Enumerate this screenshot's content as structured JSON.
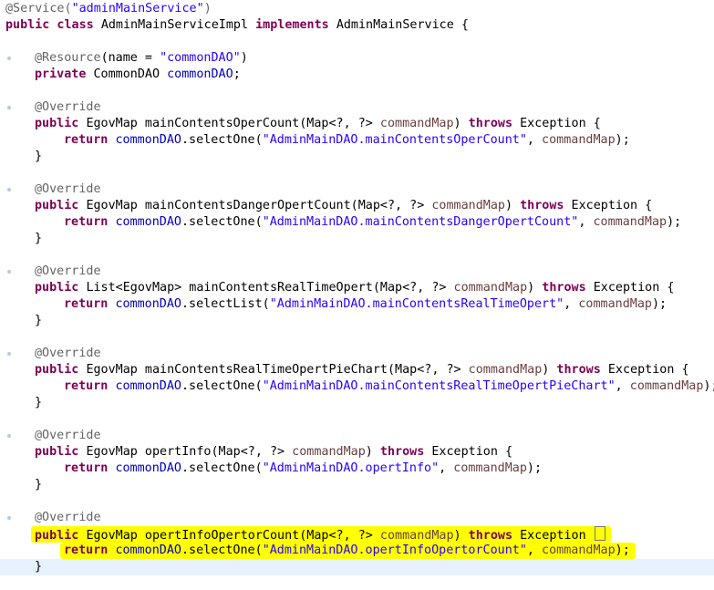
{
  "editor": {
    "lines": [
      {
        "indent": 0,
        "tokens": [
          {
            "t": "ann",
            "v": "@Service("
          },
          {
            "t": "str",
            "v": "\"adminMainService\""
          },
          {
            "t": "ann",
            "v": ")"
          }
        ]
      },
      {
        "indent": 0,
        "tokens": [
          {
            "t": "kw",
            "v": "public class "
          },
          {
            "t": "txt",
            "v": "AdminMainServiceImpl "
          },
          {
            "t": "kw",
            "v": "implements "
          },
          {
            "t": "txt",
            "v": "AdminMainService {"
          }
        ]
      },
      {
        "indent": 0,
        "tokens": []
      },
      {
        "indent": 1,
        "mark": true,
        "tokens": [
          {
            "t": "ann",
            "v": "@Resource"
          },
          {
            "t": "txt",
            "v": "(name = "
          },
          {
            "t": "str",
            "v": "\"commonDAO\""
          },
          {
            "t": "txt",
            "v": ")"
          }
        ]
      },
      {
        "indent": 1,
        "tokens": [
          {
            "t": "kw",
            "v": "private "
          },
          {
            "t": "txt",
            "v": "CommonDAO "
          },
          {
            "t": "fld",
            "v": "commonDAO"
          },
          {
            "t": "txt",
            "v": ";"
          }
        ]
      },
      {
        "indent": 0,
        "tokens": []
      },
      {
        "indent": 1,
        "mark": true,
        "tokens": [
          {
            "t": "ann",
            "v": "@Override"
          }
        ]
      },
      {
        "indent": 1,
        "tokens": [
          {
            "t": "kw",
            "v": "public "
          },
          {
            "t": "txt",
            "v": "EgovMap mainContentsOperCount(Map<?, ?> "
          },
          {
            "t": "prm",
            "v": "commandMap"
          },
          {
            "t": "txt",
            "v": ") "
          },
          {
            "t": "kw",
            "v": "throws "
          },
          {
            "t": "txt",
            "v": "Exception {"
          }
        ]
      },
      {
        "indent": 2,
        "tokens": [
          {
            "t": "kw",
            "v": "return "
          },
          {
            "t": "fld",
            "v": "commonDAO"
          },
          {
            "t": "txt",
            "v": ".selectOne("
          },
          {
            "t": "str",
            "v": "\"AdminMainDAO.mainContentsOperCount\""
          },
          {
            "t": "txt",
            "v": ", "
          },
          {
            "t": "prm",
            "v": "commandMap"
          },
          {
            "t": "txt",
            "v": ");"
          }
        ]
      },
      {
        "indent": 1,
        "tokens": [
          {
            "t": "txt",
            "v": "}"
          }
        ]
      },
      {
        "indent": 0,
        "tokens": []
      },
      {
        "indent": 1,
        "mark": true,
        "tokens": [
          {
            "t": "ann",
            "v": "@Override"
          }
        ]
      },
      {
        "indent": 1,
        "tokens": [
          {
            "t": "kw",
            "v": "public "
          },
          {
            "t": "txt",
            "v": "EgovMap mainContentsDangerOpertCount(Map<?, ?> "
          },
          {
            "t": "prm",
            "v": "commandMap"
          },
          {
            "t": "txt",
            "v": ") "
          },
          {
            "t": "kw",
            "v": "throws "
          },
          {
            "t": "txt",
            "v": "Exception {"
          }
        ]
      },
      {
        "indent": 2,
        "tokens": [
          {
            "t": "kw",
            "v": "return "
          },
          {
            "t": "fld",
            "v": "commonDAO"
          },
          {
            "t": "txt",
            "v": ".selectOne("
          },
          {
            "t": "str",
            "v": "\"AdminMainDAO.mainContentsDangerOpertCount\""
          },
          {
            "t": "txt",
            "v": ", "
          },
          {
            "t": "prm",
            "v": "commandMap"
          },
          {
            "t": "txt",
            "v": ");"
          }
        ]
      },
      {
        "indent": 1,
        "tokens": [
          {
            "t": "txt",
            "v": "}"
          }
        ]
      },
      {
        "indent": 0,
        "tokens": []
      },
      {
        "indent": 1,
        "mark": true,
        "tokens": [
          {
            "t": "ann",
            "v": "@Override"
          }
        ]
      },
      {
        "indent": 1,
        "tokens": [
          {
            "t": "kw",
            "v": "public "
          },
          {
            "t": "txt",
            "v": "List<EgovMap> mainContentsRealTimeOpert(Map<?, ?> "
          },
          {
            "t": "prm",
            "v": "commandMap"
          },
          {
            "t": "txt",
            "v": ") "
          },
          {
            "t": "kw",
            "v": "throws "
          },
          {
            "t": "txt",
            "v": "Exception {"
          }
        ]
      },
      {
        "indent": 2,
        "tokens": [
          {
            "t": "kw",
            "v": "return "
          },
          {
            "t": "fld",
            "v": "commonDAO"
          },
          {
            "t": "txt",
            "v": ".selectList("
          },
          {
            "t": "str",
            "v": "\"AdminMainDAO.mainContentsRealTimeOpert\""
          },
          {
            "t": "txt",
            "v": ", "
          },
          {
            "t": "prm",
            "v": "commandMap"
          },
          {
            "t": "txt",
            "v": ");"
          }
        ]
      },
      {
        "indent": 1,
        "tokens": [
          {
            "t": "txt",
            "v": "}"
          }
        ]
      },
      {
        "indent": 0,
        "tokens": []
      },
      {
        "indent": 1,
        "mark": true,
        "tokens": [
          {
            "t": "ann",
            "v": "@Override"
          }
        ]
      },
      {
        "indent": 1,
        "tokens": [
          {
            "t": "kw",
            "v": "public "
          },
          {
            "t": "txt",
            "v": "EgovMap mainContentsRealTimeOpertPieChart(Map<?, ?> "
          },
          {
            "t": "prm",
            "v": "commandMap"
          },
          {
            "t": "txt",
            "v": ") "
          },
          {
            "t": "kw",
            "v": "throws "
          },
          {
            "t": "txt",
            "v": "Exception {"
          }
        ]
      },
      {
        "indent": 2,
        "tokens": [
          {
            "t": "kw",
            "v": "return "
          },
          {
            "t": "fld",
            "v": "commonDAO"
          },
          {
            "t": "txt",
            "v": ".selectOne("
          },
          {
            "t": "str",
            "v": "\"AdminMainDAO.mainContentsRealTimeOpertPieChart\""
          },
          {
            "t": "txt",
            "v": ", "
          },
          {
            "t": "prm",
            "v": "commandMap"
          },
          {
            "t": "txt",
            "v": ");"
          }
        ]
      },
      {
        "indent": 1,
        "tokens": [
          {
            "t": "txt",
            "v": "}"
          }
        ]
      },
      {
        "indent": 0,
        "tokens": []
      },
      {
        "indent": 1,
        "mark": true,
        "tokens": [
          {
            "t": "ann",
            "v": "@Override"
          }
        ]
      },
      {
        "indent": 1,
        "tokens": [
          {
            "t": "kw",
            "v": "public "
          },
          {
            "t": "txt",
            "v": "EgovMap opertInfo(Map<?, ?> "
          },
          {
            "t": "prm",
            "v": "commandMap"
          },
          {
            "t": "txt",
            "v": ") "
          },
          {
            "t": "kw",
            "v": "throws "
          },
          {
            "t": "txt",
            "v": "Exception {"
          }
        ]
      },
      {
        "indent": 2,
        "tokens": [
          {
            "t": "kw",
            "v": "return "
          },
          {
            "t": "fld",
            "v": "commonDAO"
          },
          {
            "t": "txt",
            "v": ".selectOne("
          },
          {
            "t": "str",
            "v": "\"AdminMainDAO.opertInfo\""
          },
          {
            "t": "txt",
            "v": ", "
          },
          {
            "t": "prm",
            "v": "commandMap"
          },
          {
            "t": "txt",
            "v": ");"
          }
        ]
      },
      {
        "indent": 1,
        "tokens": [
          {
            "t": "txt",
            "v": "}"
          }
        ]
      },
      {
        "indent": 0,
        "tokens": []
      },
      {
        "indent": 1,
        "mark": true,
        "tokens": [
          {
            "t": "ann",
            "v": "@Override"
          }
        ]
      },
      {
        "indent": 1,
        "highlight": true,
        "tokens": [
          {
            "t": "kw",
            "v": "public "
          },
          {
            "t": "txt",
            "v": "EgovMap opertInfoOpertorCount(Map<?, ?> "
          },
          {
            "t": "prm",
            "v": "commandMap"
          },
          {
            "t": "txt",
            "v": ") "
          },
          {
            "t": "kw",
            "v": "throws "
          },
          {
            "t": "txt",
            "v": "Exception "
          },
          {
            "t": "caret",
            "v": ""
          }
        ]
      },
      {
        "indent": 2,
        "highlight": true,
        "tokens": [
          {
            "t": "kw",
            "v": "return "
          },
          {
            "t": "fld",
            "v": "commonDAO"
          },
          {
            "t": "txt",
            "v": ".selectOne("
          },
          {
            "t": "str",
            "v": "\"AdminMainDAO.opertInfoOpertorCount\""
          },
          {
            "t": "txt",
            "v": ", "
          },
          {
            "t": "prm",
            "v": "commandMap"
          },
          {
            "t": "txt",
            "v": ");"
          }
        ]
      },
      {
        "indent": 1,
        "current": true,
        "tokens": [
          {
            "t": "txt",
            "v": "}"
          }
        ]
      }
    ]
  },
  "colors": {
    "keyword": "#7f0055",
    "annotation": "#646464",
    "string": "#2a00ff",
    "field": "#0000c0",
    "parameter": "#6a3e3e",
    "highlight": "#ffff00",
    "current_line": "#e8f2fe"
  }
}
